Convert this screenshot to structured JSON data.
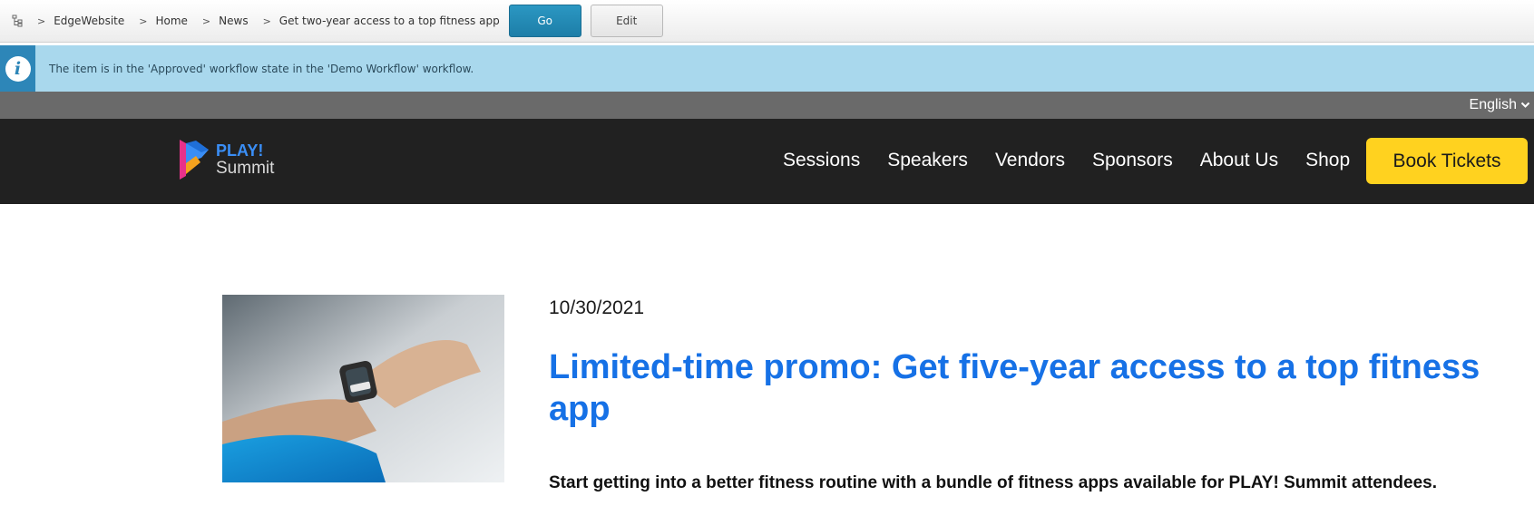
{
  "ribbon": {
    "tree_icon": "tree-icon",
    "breadcrumbs": [
      {
        "label": "EdgeWebsite"
      },
      {
        "label": "Home"
      },
      {
        "label": "News"
      },
      {
        "label": "Get two-year access to a top fitness app"
      }
    ],
    "go_label": "Go",
    "edit_label": "Edit",
    "accent": "#1d7ea8"
  },
  "notification": {
    "icon": "info-icon",
    "message": "The item is in the 'Approved' workflow state in the 'Demo Workflow' workflow."
  },
  "language": {
    "selected": "English",
    "icon": "chevron-down-icon"
  },
  "header": {
    "logo": {
      "line1": "PLAY!",
      "line2": "Summit"
    },
    "nav": [
      {
        "label": "Sessions"
      },
      {
        "label": "Speakers"
      },
      {
        "label": "Vendors"
      },
      {
        "label": "Sponsors"
      },
      {
        "label": "About Us"
      },
      {
        "label": "Shop"
      }
    ],
    "cta_label": "Book Tickets",
    "cta_color": "#ffd21f",
    "background": "#212121"
  },
  "article": {
    "date": "10/30/2021",
    "title": "Limited-time promo: Get five-year access to a top fitness app",
    "summary": "Start getting into a better fitness routine with a bundle of fitness apps available for PLAY! Summit attendees.",
    "title_color": "#1671e6"
  }
}
